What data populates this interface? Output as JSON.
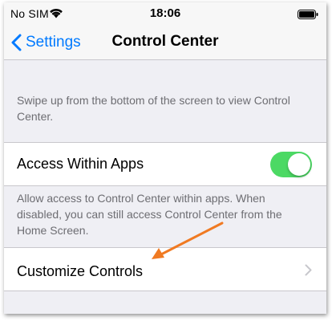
{
  "status_bar": {
    "carrier": "No SIM",
    "time": "18:06",
    "icons": [
      "wifi-icon",
      "battery-icon"
    ]
  },
  "nav": {
    "back_label": "Settings",
    "back_icon": "chevron-left-icon",
    "title": "Control Center"
  },
  "intro": {
    "text": "Swipe up from the bottom of the screen to view Control Center."
  },
  "access_within_apps": {
    "label": "Access Within Apps",
    "toggle_on": true,
    "footer": "Allow access to Control Center within apps. When disabled, you can still access Control Center from the Home Screen."
  },
  "customize_controls": {
    "label": "Customize Controls",
    "icon": "chevron-right-icon"
  },
  "colors": {
    "accent": "#007aff",
    "toggle_on": "#4cd964",
    "background": "#efeff4",
    "footer_text": "#6d6d72",
    "annotation_arrow": "#f07a22"
  }
}
